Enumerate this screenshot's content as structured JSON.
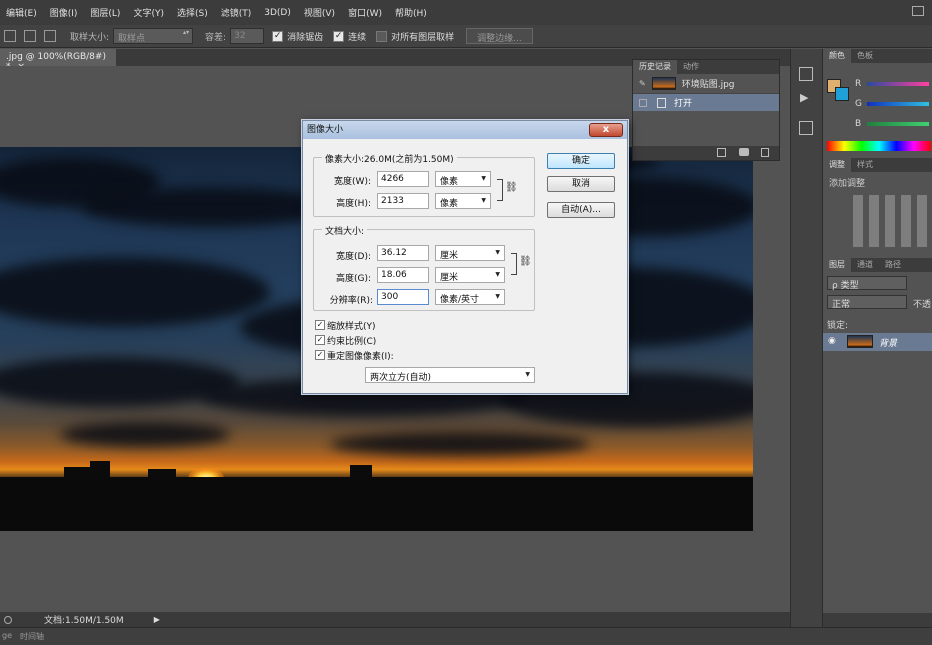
{
  "menu": [
    "编辑(E)",
    "图像(I)",
    "图层(L)",
    "文字(Y)",
    "选择(S)",
    "滤镜(T)",
    "3D(D)",
    "视图(V)",
    "窗口(W)",
    "帮助(H)"
  ],
  "options": {
    "sample_size_label": "取样大小:",
    "sample_size_value": "取样点",
    "tolerance_label": "容差:",
    "tolerance_value": "32",
    "antialias_label": "消除锯齿",
    "contiguous_label": "连续",
    "all_layers_label": "对所有图层取样",
    "refine_edge_label": "调整边缘..."
  },
  "document": {
    "tab_label": ".jpg @ 100%(RGB/8#) *",
    "close": "×"
  },
  "status": {
    "doc_size": "文档:1.50M/1.50M"
  },
  "timeline": {
    "left": "ge",
    "label": "时间轴"
  },
  "history": {
    "tabs": [
      "历史记录",
      "动作"
    ],
    "snapshot_label": "环境贴图.jpg",
    "step_open": "打开"
  },
  "right_panels": {
    "color_tabs": [
      "颜色",
      "色板"
    ],
    "channels": [
      "R",
      "G",
      "B"
    ],
    "adjust_tabs": [
      "调整",
      "样式"
    ],
    "adjust_title": "添加调整",
    "layers_tabs": [
      "图层",
      "通道",
      "路径"
    ],
    "kind_filter": "ρ 类型",
    "blend_mode": "正常",
    "opacity_label": "不透",
    "lock_label": "锁定:",
    "layer_name": "背景"
  },
  "dialog": {
    "title": "图像大小",
    "close": "x",
    "pixel_legend": "像素大小:26.0M(之前为1.50M)",
    "width_label": "宽度(W):",
    "width_value": "4266",
    "width_unit": "像素",
    "height_label": "高度(H):",
    "height_value": "2133",
    "height_unit": "像素",
    "doc_legend": "文档大小:",
    "doc_width_label": "宽度(D):",
    "doc_width_value": "36.12",
    "doc_width_unit": "厘米",
    "doc_height_label": "高度(G):",
    "doc_height_value": "18.06",
    "doc_height_unit": "厘米",
    "resolution_label": "分辨率(R):",
    "resolution_value": "300",
    "resolution_unit": "像素/英寸",
    "scale_styles_label": "缩放样式(Y)",
    "constrain_label": "约束比例(C)",
    "resample_label": "重定图像像素(I):",
    "resample_method": "两次立方(自动)",
    "ok_label": "确定",
    "cancel_label": "取消",
    "auto_label": "自动(A)..."
  }
}
